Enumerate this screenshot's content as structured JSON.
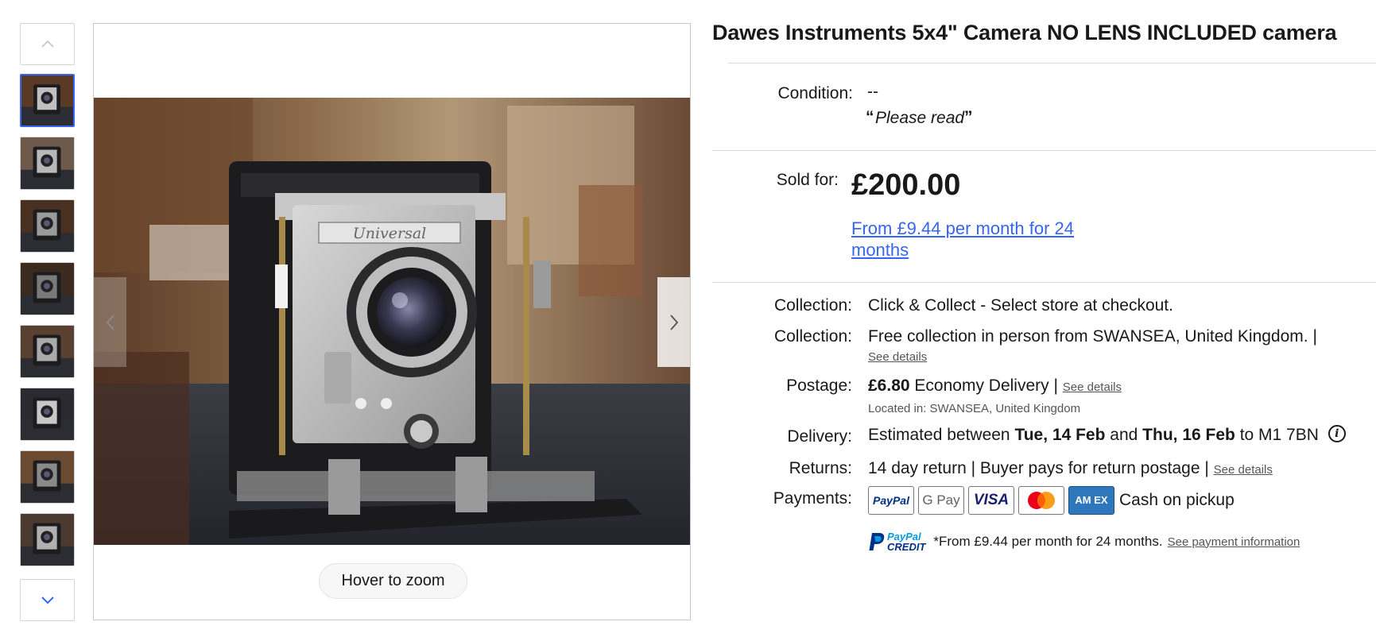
{
  "gallery": {
    "thumbnail_count": 8,
    "selected_index": 0,
    "zoom_hint": "Hover to zoom",
    "icons": {
      "scroll_up": "chevron-up-icon",
      "scroll_down": "chevron-down-icon",
      "previous": "chevron-left-icon",
      "next": "chevron-right-icon"
    },
    "photo_wordmark": "Universal"
  },
  "listing": {
    "title": "Dawes Instruments 5x4\" Camera NO LENS INCLUDED camera"
  },
  "condition": {
    "label": "Condition:",
    "value": "--",
    "quote_open": "“",
    "quote_text": "Please read",
    "quote_close": "”"
  },
  "price": {
    "label": "Sold for:",
    "amount": "£200.00",
    "finance_link": "From £9.44 per month for 24 months"
  },
  "shipping": {
    "collection1": {
      "label": "Collection:",
      "value": "Click & Collect - Select store at checkout."
    },
    "collection2": {
      "label": "Collection:",
      "value": "Free collection in person from SWANSEA, United Kingdom. |",
      "link": "See details"
    },
    "postage": {
      "label": "Postage:",
      "amount": "£6.80",
      "method": "Economy Delivery |",
      "link": "See details",
      "located": "Located in: SWANSEA, United Kingdom"
    },
    "delivery": {
      "label": "Delivery:",
      "prefix": "Estimated between",
      "date1": "Tue, 14 Feb",
      "and": "and",
      "date2": "Thu, 16 Feb",
      "suffix": "to M1 7BN",
      "info_icon": "info-icon",
      "info_glyph": "i"
    },
    "returns": {
      "label": "Returns:",
      "value": "14 day return | Buyer pays for return postage |",
      "link": "See details"
    }
  },
  "payments": {
    "label": "Payments:",
    "methods": [
      {
        "name": "PayPal",
        "icon": "paypal-icon",
        "text": "PayPal",
        "color": "#003087"
      },
      {
        "name": "Google Pay",
        "icon": "google-pay-icon",
        "text": "G Pay",
        "color": "#5f6368"
      },
      {
        "name": "Visa",
        "icon": "visa-icon",
        "text": "VISA",
        "color": "#1a1f71"
      },
      {
        "name": "Mastercard",
        "icon": "mastercard-icon",
        "colors": [
          "#eb001b",
          "#f79e1b"
        ]
      },
      {
        "name": "American Express",
        "icon": "amex-icon",
        "text": "AM EX",
        "color": "#2e77bc"
      }
    ],
    "cash": "Cash on pickup"
  },
  "credit": {
    "logo_line1": "PayPal",
    "logo_line2": "CREDIT",
    "text": "*From £9.44 per month for 24 months.",
    "link": "See payment information"
  },
  "colors": {
    "link_blue": "#3665f3",
    "selected_border": "#3665f3",
    "text": "#191919",
    "muted": "#555555",
    "divider": "#dcdcdc"
  }
}
